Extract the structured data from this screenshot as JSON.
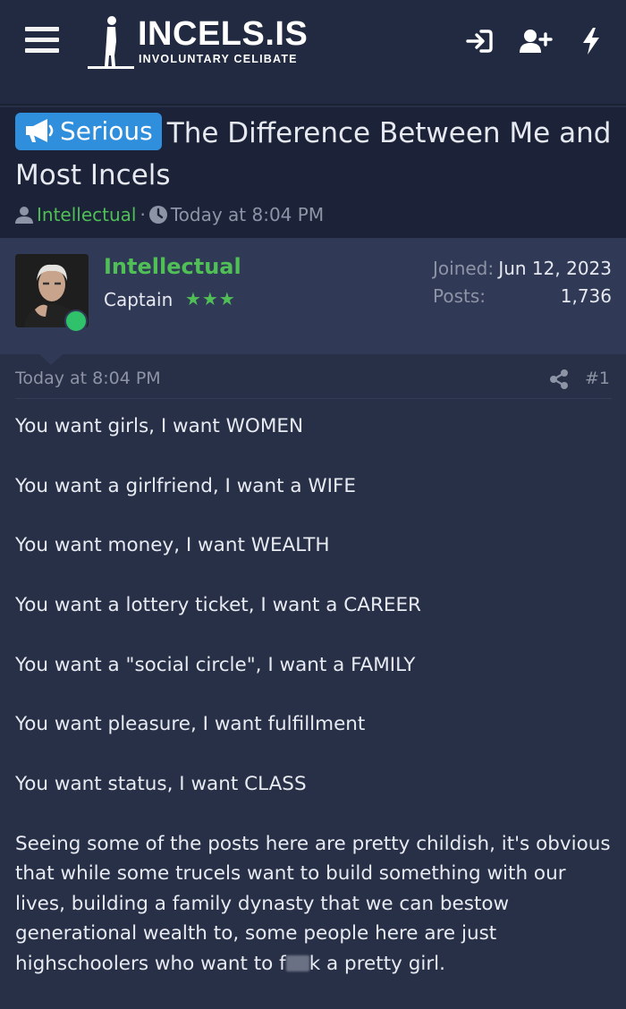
{
  "header": {
    "logo_title": "INCELS.IS",
    "logo_subtitle": "INVOLUNTARY CELIBATE",
    "icons": [
      "menu-icon",
      "login-icon",
      "register-icon",
      "whats-new-icon"
    ]
  },
  "thread": {
    "prefix_label": "Serious",
    "title": "The Difference Between Me and Most Incels",
    "author": "Intellectual",
    "separator": "·",
    "time": "Today at 8:04 PM"
  },
  "author_panel": {
    "name": "Intellectual",
    "rank": "Captain",
    "stars": "★★★",
    "joined_label": "Joined:",
    "joined_value": "Jun 12, 2023",
    "posts_label": "Posts:",
    "posts_value": "1,736",
    "online": true
  },
  "post": {
    "date": "Today at 8:04 PM",
    "number": "#1",
    "lines": [
      "You want girls, I want WOMEN",
      "You want a girlfriend, I want a WIFE",
      "You want money, I want WEALTH",
      "You want a lottery ticket, I want a CAREER",
      "You want a \"social circle\", I want a FAMILY",
      "You want pleasure, I want fulfillment",
      "You want status, I want CLASS"
    ],
    "paragraph_start": "Seeing some of the posts here are pretty childish, it's obvious that while some trucels want to build something with our lives, building a family dynasty that we can bestow generational wealth to, some people here are just highschoolers who want to f",
    "paragraph_end": "k a pretty girl."
  },
  "colors": {
    "page_bg": "#283047",
    "header_bg": "#212a40",
    "thread_bg": "#1c2338",
    "panel_bg": "#303a56",
    "accent_green": "#4fbf56",
    "badge_blue": "#2f8fdd",
    "online_green": "#2fc26b",
    "muted_text": "#8d94a6"
  }
}
